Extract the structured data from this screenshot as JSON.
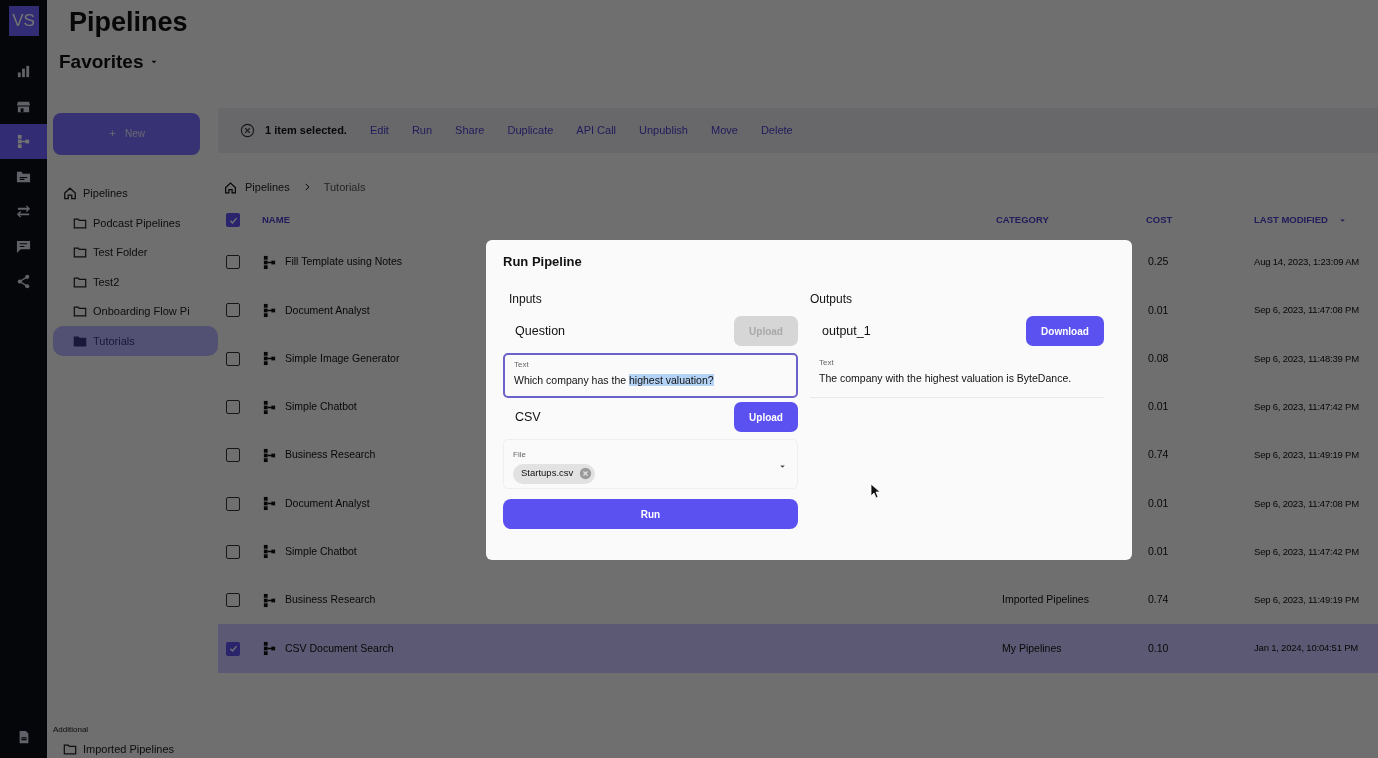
{
  "rail": {
    "logo": "VS",
    "items": [
      {
        "selected": false
      },
      {
        "selected": false
      },
      {
        "selected": true
      },
      {
        "selected": false
      },
      {
        "selected": false
      },
      {
        "selected": false
      },
      {
        "selected": false
      }
    ],
    "bottom_items": [
      {
        "selected": false
      }
    ]
  },
  "header": {
    "title": "Pipelines",
    "favorites": "Favorites"
  },
  "sidebar": {
    "new_button": "New",
    "tree": [
      {
        "label": "Pipelines",
        "selected": false,
        "children": [
          {
            "label": "Podcast Pipelines",
            "selected": false
          },
          {
            "label": "Test Folder",
            "selected": false
          },
          {
            "label": "Test2",
            "selected": false
          },
          {
            "label": "Onboarding Flow Pi",
            "selected": false
          },
          {
            "label": "Tutorials",
            "selected": true
          }
        ]
      }
    ],
    "additional": {
      "heading": "Additional",
      "items": [
        {
          "label": "Imported Pipelines",
          "selected": false
        }
      ]
    }
  },
  "toolbar": {
    "selection": "1 item selected.",
    "actions": [
      "Edit",
      "Run",
      "Share",
      "Duplicate",
      "API Call",
      "Unpublish",
      "Move",
      "Delete"
    ]
  },
  "breadcrumb": [
    "Pipelines",
    "Tutorials"
  ],
  "table": {
    "select_all": true,
    "columns": [
      "NAME",
      "CATEGORY",
      "COST",
      "LAST MODIFIED"
    ],
    "rows": [
      {
        "name": "Fill Template using Notes",
        "cost": "0.25",
        "last_modified": "Aug 14, 2023, 1:23:09 AM",
        "checked": false
      },
      {
        "name": "Document Analyst",
        "cost": "0.01",
        "last_modified": "Sep 6, 2023, 11:47:08 PM",
        "checked": false
      },
      {
        "name": "Simple Image Generator",
        "cost": "0.08",
        "last_modified": "Sep 6, 2023, 11:48:39 PM",
        "checked": false
      },
      {
        "name": "Simple Chatbot",
        "cost": "0.01",
        "last_modified": "Sep 6, 2023, 11:47:42 PM",
        "checked": false
      },
      {
        "name": "Business Research",
        "cost": "0.74",
        "last_modified": "Sep 6, 2023, 11:49:19 PM",
        "checked": false
      },
      {
        "name": "Document Analyst",
        "cost": "0.01",
        "last_modified": "Sep 6, 2023, 11:47:08 PM",
        "checked": false
      },
      {
        "name": "Simple Chatbot",
        "cost": "0.01",
        "last_modified": "Sep 6, 2023, 11:47:42 PM",
        "checked": false
      },
      {
        "name": "Business Research",
        "category": "Imported Pipelines",
        "cost": "0.74",
        "last_modified": "Sep 6, 2023, 11:49:19 PM",
        "checked": false
      },
      {
        "name": "CSV Document Search",
        "category": "My Pipelines",
        "cost": "0.10",
        "last_modified": "Jan 1, 2024, 10:04:51 PM",
        "checked": true
      }
    ]
  },
  "modal": {
    "title": "Run Pipeline",
    "inputs_heading": "Inputs",
    "outputs_heading": "Outputs",
    "inputs": [
      {
        "label": "Question",
        "upload": "Upload",
        "upload_disabled": true,
        "field": {
          "kind": "text",
          "label": "Text",
          "value": "Which company has the ",
          "highlighted": "highest valuation?",
          "focused": true
        }
      },
      {
        "label": "CSV",
        "upload": "Upload",
        "upload_disabled": false,
        "field": {
          "kind": "file",
          "label": "File",
          "chips": [
            "Startups.csv"
          ],
          "focused": false
        }
      }
    ],
    "run_button": "Run",
    "outputs": [
      {
        "label": "output_1",
        "download": "Download",
        "field": {
          "label": "Text",
          "value": "The company with the highest valuation is ByteDance."
        }
      }
    ]
  }
}
